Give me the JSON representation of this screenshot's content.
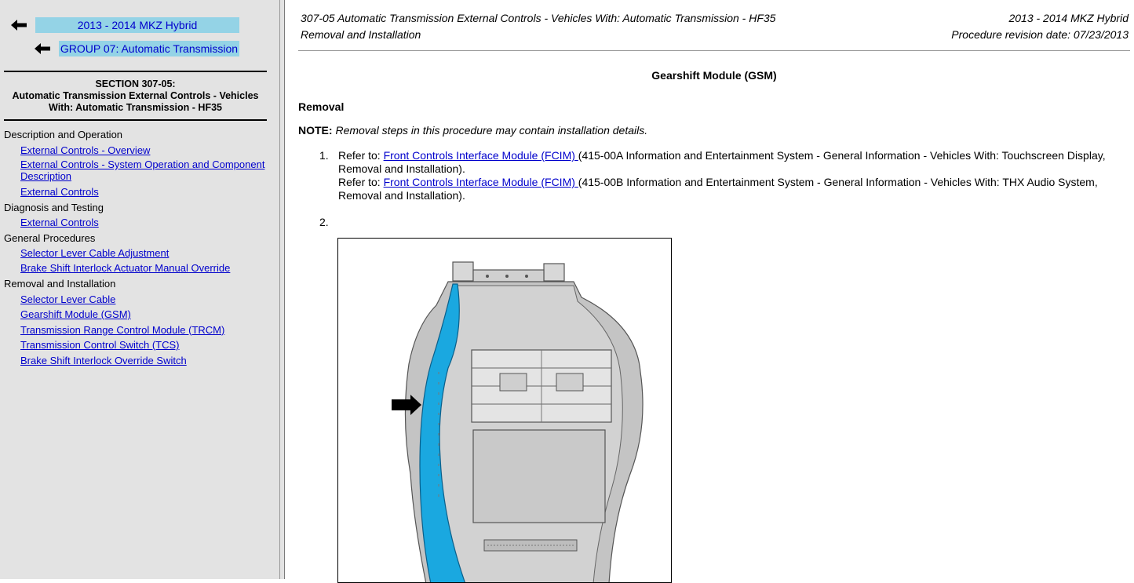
{
  "sidebar": {
    "nav_vehicle": "2013 - 2014 MKZ Hybrid",
    "nav_group": "GROUP 07: Automatic Transmission",
    "section_title_line1": "SECTION 307-05:",
    "section_title_line2": "Automatic Transmission External Controls - Vehicles With: Automatic Transmission - HF35",
    "toc": [
      {
        "group": "Description and Operation",
        "links": [
          "External Controls - Overview",
          "External Controls - System Operation and Component Description",
          "External Controls"
        ]
      },
      {
        "group": "Diagnosis and Testing",
        "links": [
          "External Controls"
        ]
      },
      {
        "group": "General Procedures",
        "links": [
          "Selector Lever Cable Adjustment",
          "Brake Shift Interlock Actuator Manual Override"
        ]
      },
      {
        "group": "Removal and Installation",
        "links": [
          "Selector Lever Cable",
          "Gearshift Module (GSM)",
          "Transmission Range Control Module (TRCM)",
          "Transmission Control Switch (TCS)",
          "Brake Shift Interlock Override Switch"
        ]
      }
    ]
  },
  "header": {
    "section": "307-05 Automatic Transmission External Controls - Vehicles With: Automatic Transmission - HF35",
    "type": "Removal and Installation",
    "vehicle": "2013 - 2014 MKZ Hybrid",
    "revision": "Procedure revision date: 07/23/2013"
  },
  "content": {
    "title": "Gearshift Module (GSM)",
    "subheading": "Removal",
    "note_label": "NOTE:",
    "note_text": "Removal steps in this procedure may contain installation details.",
    "step1": {
      "number": "1.",
      "refer_label": "Refer to:",
      "link1": "Front Controls Interface Module (FCIM) ",
      "text1": "(415-00A Information and Entertainment System - General Information - Vehicles With: Touchscreen Display, Removal and Installation).",
      "link2": "Front Controls Interface Module (FCIM) ",
      "text2": "(415-00B Information and Entertainment System - General Information - Vehicles With: THX Audio System, Removal and Installation)."
    },
    "step2": {
      "number": "2."
    }
  },
  "colors": {
    "nav_highlight": "#94d3e6",
    "link": "#0000cc",
    "sidebar_bg": "#e3e3e3",
    "highlight_part": "#1aa8e0"
  },
  "icons": [
    "back-arrow-icon"
  ]
}
